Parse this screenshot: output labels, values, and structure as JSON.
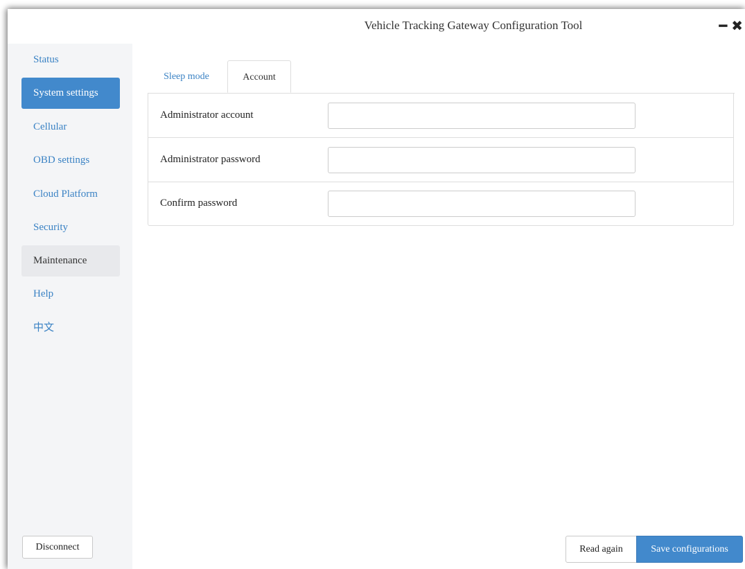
{
  "window": {
    "title": "Vehicle Tracking Gateway Configuration Tool",
    "minimize_icon": "minimize-icon",
    "close_icon": "close-icon",
    "minimize_glyph": "━",
    "close_glyph": "✖"
  },
  "sidebar": {
    "items": [
      {
        "label": "Status",
        "state": "normal"
      },
      {
        "label": "System settings",
        "state": "active"
      },
      {
        "label": "Cellular",
        "state": "normal"
      },
      {
        "label": "OBD settings",
        "state": "normal"
      },
      {
        "label": "Cloud Platform",
        "state": "normal"
      },
      {
        "label": "Security",
        "state": "normal"
      },
      {
        "label": "Maintenance",
        "state": "hover"
      },
      {
        "label": "Help",
        "state": "normal"
      },
      {
        "label": "中文",
        "state": "normal"
      }
    ],
    "disconnect_label": "Disconnect"
  },
  "tabs": [
    {
      "label": "Sleep mode",
      "active": false
    },
    {
      "label": "Account",
      "active": true
    }
  ],
  "form": {
    "rows": [
      {
        "label": "Administrator account",
        "value": "",
        "type": "text"
      },
      {
        "label": "Administrator password",
        "value": "",
        "type": "password"
      },
      {
        "label": "Confirm password",
        "value": "",
        "type": "password"
      }
    ]
  },
  "footer": {
    "read_again_label": "Read again",
    "save_label": "Save configurations"
  },
  "colors": {
    "accent": "#4289cc",
    "link": "#3a82c4",
    "sidebar_bg": "#f4f5f7"
  }
}
